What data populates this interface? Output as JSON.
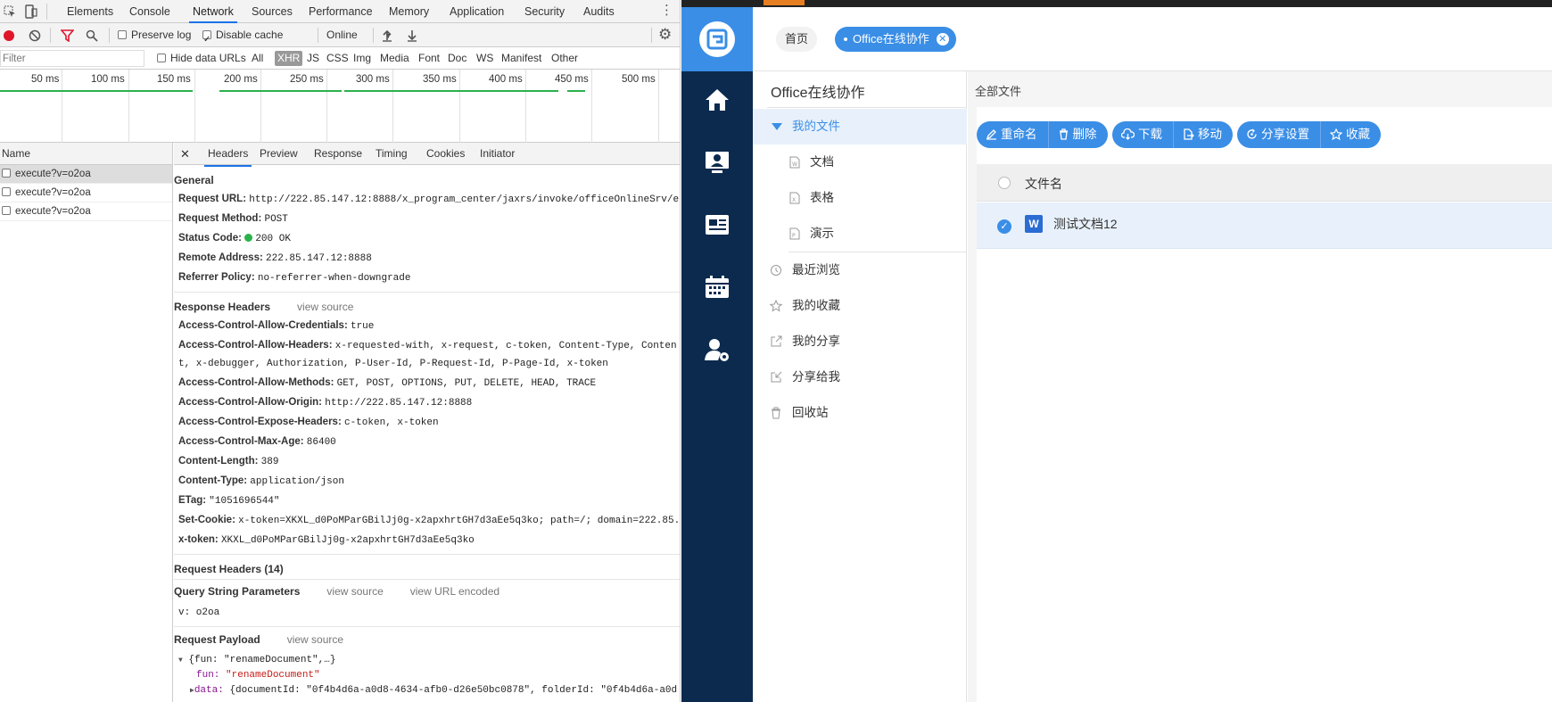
{
  "devtools": {
    "tabs": [
      "Elements",
      "Console",
      "Network",
      "Sources",
      "Performance",
      "Memory",
      "Application",
      "Security",
      "Audits"
    ],
    "active_tab": "Network",
    "toolbar": {
      "preserve_log": "Preserve log",
      "disable_cache": "Disable cache",
      "throttle": "Online"
    },
    "filter": {
      "placeholder": "Filter",
      "hide_data_urls": "Hide data URLs",
      "types": [
        "All",
        "XHR",
        "JS",
        "CSS",
        "Img",
        "Media",
        "Font",
        "Doc",
        "WS",
        "Manifest",
        "Other"
      ],
      "active_type": "XHR"
    },
    "timeline_labels": [
      "50 ms",
      "100 ms",
      "150 ms",
      "200 ms",
      "250 ms",
      "300 ms",
      "350 ms",
      "400 ms",
      "450 ms",
      "500 ms"
    ],
    "request_list": {
      "header": "Name",
      "rows": [
        "execute?v=o2oa",
        "execute?v=o2oa",
        "execute?v=o2oa"
      ]
    },
    "detail_tabs": [
      "Headers",
      "Preview",
      "Response",
      "Timing",
      "Cookies",
      "Initiator"
    ],
    "general": {
      "title": "General",
      "request_url_k": "Request URL:",
      "request_url_v": "http://222.85.147.12:8888/x_program_center/jaxrs/invoke/officeOnlineSrv/e",
      "method_k": "Request Method:",
      "method_v": "POST",
      "status_k": "Status Code:",
      "status_v": "200 OK",
      "remote_k": "Remote Address:",
      "remote_v": "222.85.147.12:8888",
      "referrer_k": "Referrer Policy:",
      "referrer_v": "no-referrer-when-downgrade"
    },
    "response_headers": {
      "title": "Response Headers",
      "view_source": "view source",
      "rows": [
        {
          "k": "Access-Control-Allow-Credentials:",
          "v": "true"
        },
        {
          "k": "Access-Control-Allow-Headers:",
          "v": "x-requested-with, x-request, c-token, Content-Type, Conten"
        },
        {
          "k": "",
          "v": "t, x-debugger, Authorization, P-User-Id, P-Request-Id, P-Page-Id, x-token"
        },
        {
          "k": "Access-Control-Allow-Methods:",
          "v": "GET, POST, OPTIONS, PUT, DELETE, HEAD, TRACE"
        },
        {
          "k": "Access-Control-Allow-Origin:",
          "v": "http://222.85.147.12:8888"
        },
        {
          "k": "Access-Control-Expose-Headers:",
          "v": "c-token, x-token"
        },
        {
          "k": "Access-Control-Max-Age:",
          "v": "86400"
        },
        {
          "k": "Content-Length:",
          "v": "389"
        },
        {
          "k": "Content-Type:",
          "v": "application/json"
        },
        {
          "k": "ETag:",
          "v": "\"1051696544\""
        },
        {
          "k": "Set-Cookie:",
          "v": "x-token=XKXL_d0PoMParGBilJj0g-x2apxhrtGH7d3aEe5q3ko; path=/; domain=222.85."
        },
        {
          "k": "x-token:",
          "v": "XKXL_d0PoMParGBilJj0g-x2apxhrtGH7d3aEe5q3ko"
        }
      ]
    },
    "request_headers": {
      "title": "Request Headers (14)"
    },
    "query_string": {
      "title": "Query String Parameters",
      "view_source": "view source",
      "view_url_encoded": "view URL encoded",
      "param": "v: o2oa"
    },
    "payload": {
      "title": "Request Payload",
      "view_source": "view source",
      "summary": "{fun: \"renameDocument\",…}",
      "fun_k": "fun:",
      "fun_v": "\"renameDocument\"",
      "data_k": "data:",
      "data_v": "{documentId: \"0f4b4d6a-a0d8-4634-afb0-d26e50bc0878\", folderId: \"0f4b4d6a-a0d"
    }
  },
  "app": {
    "breadcrumb": {
      "home": "首页",
      "current": "Office在线协作"
    },
    "sidebar": {
      "title": "Office在线协作",
      "items": [
        {
          "label": "我的文件",
          "active": true
        },
        {
          "label": "文档"
        },
        {
          "label": "表格"
        },
        {
          "label": "演示"
        },
        {
          "label": "最近浏览"
        },
        {
          "label": "我的收藏"
        },
        {
          "label": "我的分享"
        },
        {
          "label": "分享给我"
        },
        {
          "label": "回收站"
        }
      ]
    },
    "main": {
      "title": "全部文件",
      "buttons": {
        "rename": "重命名",
        "delete": "删除",
        "download": "下载",
        "move": "移动",
        "share_settings": "分享设置",
        "favorite": "收藏"
      },
      "table_header": "文件名",
      "files": [
        {
          "name": "测试文档12",
          "type": "W",
          "selected": true
        }
      ]
    },
    "colors": {
      "accent": "#3a8ee6",
      "nav": "#0b2a4e"
    }
  }
}
